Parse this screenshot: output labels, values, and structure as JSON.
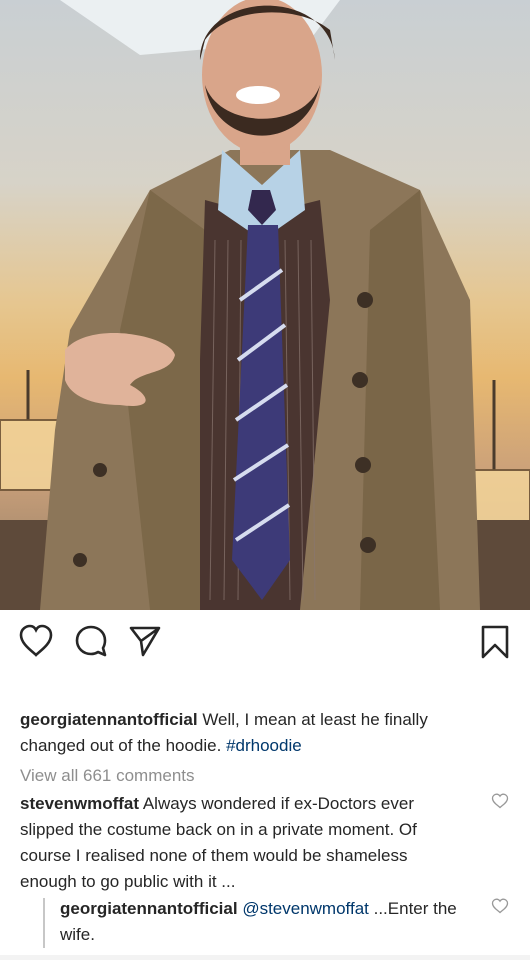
{
  "post": {
    "image_alt": "photo",
    "caption_user": "georgiatennantofficial",
    "caption_text": "Well, I mean at least he finally changed out of the hoodie.",
    "caption_hashtag": "#drhoodie",
    "view_all_comments": "View all 661 comments"
  },
  "comments": [
    {
      "user": "stevenwmoffat",
      "text": "Always wondered if ex-Doctors ever slipped the costume back on in a private moment. Of course I realised none of them would be shameless enough to go public with it ..."
    }
  ],
  "reply": {
    "user": "georgiatennantofficial",
    "mention": "@stevenwmoffat",
    "text": "...Enter the wife."
  },
  "icons": {
    "like": "heart-icon",
    "comment": "comment-bubble-icon",
    "share": "paper-plane-icon",
    "save": "bookmark-icon",
    "comment_like": "small-heart-icon"
  }
}
